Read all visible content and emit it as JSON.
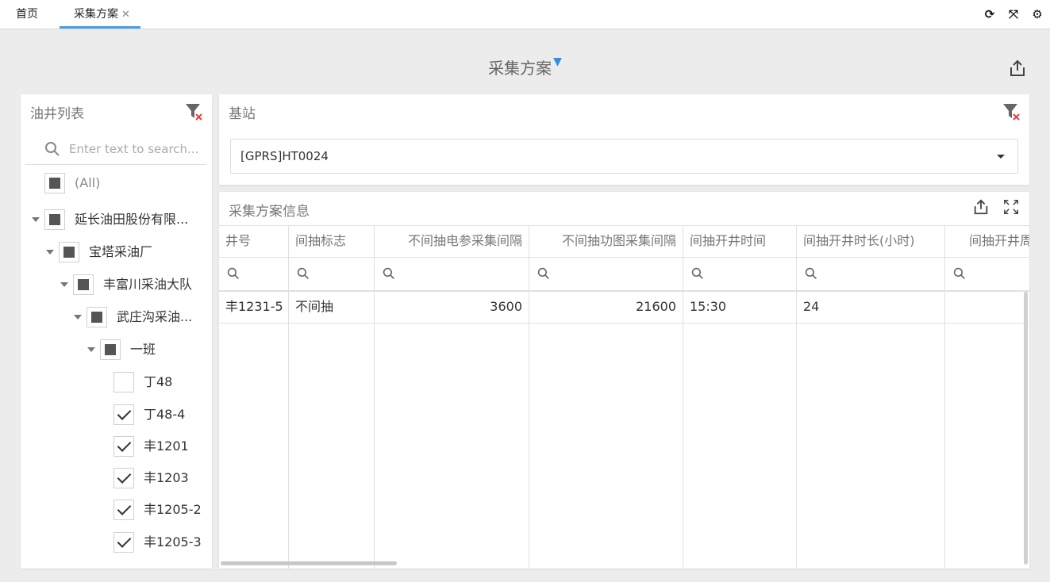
{
  "tabs": [
    {
      "label": "首页"
    },
    {
      "label": "采集方案",
      "close": "✕"
    }
  ],
  "page": {
    "title": "采集方案"
  },
  "well_list": {
    "title": "油井列表",
    "search_placeholder": "Enter text to search...",
    "nodes": [
      {
        "label": "(All)",
        "state": "partial"
      },
      {
        "label": "延长油田股份有限...",
        "state": "partial"
      },
      {
        "label": "宝塔采油厂",
        "state": "partial"
      },
      {
        "label": "丰富川采油大队",
        "state": "partial"
      },
      {
        "label": "武庄沟采油...",
        "state": "partial"
      },
      {
        "label": "一班",
        "state": "partial"
      },
      {
        "label": "丁48",
        "state": "unchecked"
      },
      {
        "label": "丁48-4",
        "state": "checked"
      },
      {
        "label": "丰1201",
        "state": "checked"
      },
      {
        "label": "丰1203",
        "state": "checked"
      },
      {
        "label": "丰1205-2",
        "state": "checked"
      },
      {
        "label": "丰1205-3",
        "state": "checked"
      }
    ]
  },
  "base_station": {
    "title": "基站",
    "selected": "[GPRS]HT0024"
  },
  "scheme_info": {
    "title": "采集方案信息",
    "columns": [
      "井号",
      "间抽标志",
      "不间抽电参采集间隔",
      "不间抽功图采集间隔",
      "间抽开井时间",
      "间抽开井时长(小时)",
      "间抽开井周"
    ],
    "rows": [
      [
        "丰1231-5",
        "不间抽",
        "3600",
        "21600",
        "15:30",
        "24",
        ""
      ]
    ]
  },
  "icons": {
    "refresh": "refresh-icon",
    "fullscreen": "fullscreen-icon",
    "settings": "gear-icon",
    "export": "export-icon",
    "filter": "filter-icon",
    "clear_filter": "clear-filter-icon",
    "search": "search-icon"
  },
  "colors": {
    "accent": "#4d9be0",
    "clear_filter_x": "#e04040"
  }
}
